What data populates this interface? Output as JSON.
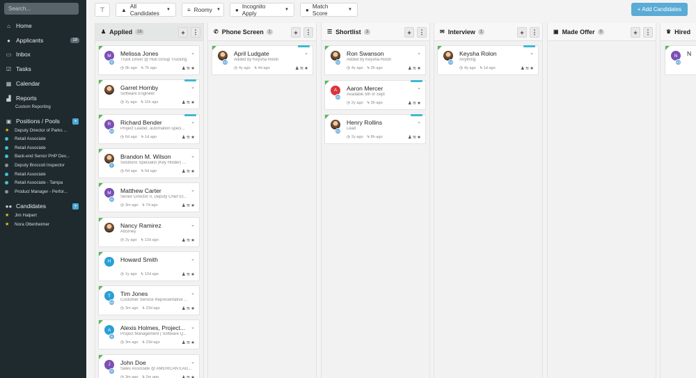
{
  "sidebar": {
    "search_placeholder": "Search...",
    "nav": [
      {
        "label": "Home",
        "icon": "home-icon"
      },
      {
        "label": "Applicants",
        "icon": "user-icon",
        "badge": "19"
      },
      {
        "label": "Inbox",
        "icon": "inbox-icon"
      },
      {
        "label": "Tasks",
        "icon": "check-square-icon"
      },
      {
        "label": "Calendar",
        "icon": "calendar-icon"
      },
      {
        "label": "Reports",
        "icon": "chart-icon"
      }
    ],
    "reports_sub": "Custom Reporting",
    "positions_label": "Positions / Pools",
    "positions": [
      {
        "label": "Deputy Director of Parks ...",
        "marker": "star",
        "color": "#f5c518"
      },
      {
        "label": "Retail Associate",
        "marker": "dot",
        "color": "#3cc3d6"
      },
      {
        "label": "Retail Associate",
        "marker": "dot",
        "color": "#3cc3d6"
      },
      {
        "label": "Back-end Senior PHP Dev...",
        "marker": "dot",
        "color": "#3cc3d6"
      },
      {
        "label": "Deputy Broccoli Inspector",
        "marker": "dot",
        "color": "#8a9296"
      },
      {
        "label": "Retail Associate",
        "marker": "dot",
        "color": "#3cc3d6"
      },
      {
        "label": "Retail Associate - Tampa",
        "marker": "dot",
        "color": "#3cc3d6"
      },
      {
        "label": "Product Manager - Perfor...",
        "marker": "dot",
        "color": "#8a9296"
      }
    ],
    "candidates_label": "Candidates",
    "candidates": [
      {
        "label": "Jim Halpert"
      },
      {
        "label": "Nora Ottenheimer"
      }
    ]
  },
  "toolbar": {
    "filter_icon": "filter-icon",
    "all_candidates": "All Candidates",
    "roomy": "Roomy",
    "incognito": "Incognito Apply",
    "match_score": "Match Score",
    "add_button": "+ Add Candidates"
  },
  "colors": {
    "accent": "#5aabd5",
    "sidebar_bg": "#1f2a2f",
    "new_marker": "#5cb85c",
    "teal": "#3fb8d0"
  },
  "columns": [
    {
      "title": "Applied",
      "count": "16",
      "icon": "lock-icon"
    },
    {
      "title": "Phone Screen",
      "count": "1",
      "icon": "phone-icon"
    },
    {
      "title": "Shortlist",
      "count": "3",
      "icon": "list-icon"
    },
    {
      "title": "Interview",
      "count": "1",
      "icon": "chat-icon"
    },
    {
      "title": "Made Offer",
      "count": "0",
      "icon": "gift-icon"
    },
    {
      "title": "Hired",
      "icon": "trophy-icon"
    }
  ],
  "cards": {
    "applied": [
      {
        "name": "Melissa Jones",
        "sub": "Truck Driver @ Hub Group Trucking",
        "t1": "9h ago",
        "t2": "7h ago",
        "initial": "M",
        "color": "#7b4fb5",
        "mini": "B"
      },
      {
        "name": "Garret Hornby",
        "sub": "Software Engineer",
        "t1": "2y ago",
        "t2": "11h ago",
        "photo": true
      },
      {
        "name": "Richard Bender",
        "sub": "Project Leader, automation speci...",
        "t1": "6d ago",
        "t2": "1d ago",
        "initial": "R",
        "color": "#7b4fb5",
        "mini": "64"
      },
      {
        "name": "Brandon M. Wilson",
        "sub": "Solutions Specialist (Key Holder) ...",
        "t1": "6d ago",
        "t2": "6d ago",
        "photo": true,
        "mini": "T"
      },
      {
        "name": "Matthew Carter",
        "sub": "Senior Director II, Deputy Chief Et...",
        "t1": "3m ago",
        "t2": "7d ago",
        "initial": "M",
        "color": "#7b4fb5",
        "mini": "B"
      },
      {
        "name": "Nancy Ramirez",
        "sub": "Attorney",
        "t1": "2y ago",
        "t2": "12d ago",
        "photo": true
      },
      {
        "name": "Howard Smith",
        "sub": "",
        "t1": "1y ago",
        "t2": "12d ago",
        "initial": "H",
        "color": "#2a9fd6"
      },
      {
        "name": "Tim Jones",
        "sub": "Customer Service Representative ...",
        "t1": "3m ago",
        "t2": "23d ago",
        "initial": "T",
        "color": "#2a9fd6",
        "mini": "64"
      },
      {
        "name": "Alexis Holmes, Project...",
        "sub": "Project Management | Software Q...",
        "t1": "3m ago",
        "t2": "23d ago",
        "initial": "A",
        "color": "#2a9fd6",
        "mini": "B"
      },
      {
        "name": "John Doe",
        "sub": "Sales Associate @ AMERICAN EAG...",
        "t1": "3m ago",
        "t2": "2m ago",
        "initial": "J",
        "color": "#7b4fb5",
        "mini": "B"
      }
    ],
    "phone": [
      {
        "name": "April Ludgate",
        "sub": "Added by Keysha Rolon",
        "t1": "4y ago",
        "t2": "4d ago",
        "photo": true,
        "mini": "43"
      }
    ],
    "shortlist": [
      {
        "name": "Ron Swanson",
        "sub": "Added by Keysha Rolon",
        "t1": "4y ago",
        "t2": "3h ago",
        "photo": true,
        "mini": "42"
      },
      {
        "name": "Aaron Mercer",
        "sub": "Available 5th of Sept",
        "t1": "2y ago",
        "t2": "3h ago",
        "initial": "A",
        "color": "#d9343c",
        "mini": "43"
      },
      {
        "name": "Henry Rollins",
        "sub": "Lead",
        "t1": "2y ago",
        "t2": "8h ago",
        "photo": true,
        "mini": "42"
      }
    ],
    "interview": [
      {
        "name": "Keysha Rolon",
        "sub": "Anything",
        "t1": "4y ago",
        "t2": "1d ago",
        "photo": true,
        "mini": "43"
      }
    ],
    "hired": [
      {
        "name": "N",
        "initial": "N",
        "color": "#7b4fb5",
        "mini": "43"
      }
    ]
  }
}
